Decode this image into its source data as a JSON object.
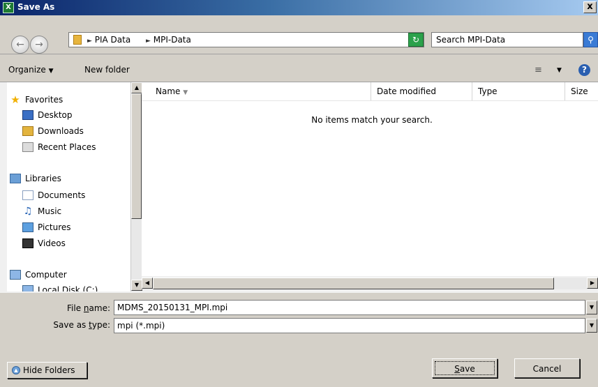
{
  "window": {
    "title": "Save As",
    "close_glyph": "x"
  },
  "address": {
    "crumbs": [
      "PIA Data",
      "MPI-Data"
    ],
    "search_placeholder": "Search MPI-Data"
  },
  "toolbar": {
    "organize_label": "Organize",
    "new_folder_label": "New folder"
  },
  "navigation": {
    "items": [
      {
        "label": "Favorites",
        "icon": "star-icon"
      },
      {
        "label": "Desktop",
        "icon": "desktop-icon"
      },
      {
        "label": "Downloads",
        "icon": "downloads-folder-icon"
      },
      {
        "label": "Recent Places",
        "icon": "recent-places-icon"
      },
      {
        "label": "Libraries",
        "icon": "libraries-icon"
      },
      {
        "label": "Documents",
        "icon": "documents-icon"
      },
      {
        "label": "Music",
        "icon": "music-icon"
      },
      {
        "label": "Pictures",
        "icon": "pictures-icon"
      },
      {
        "label": "Videos",
        "icon": "videos-icon"
      },
      {
        "label": "Computer",
        "icon": "computer-icon"
      },
      {
        "label": "Local Disk (C:)",
        "icon": "disk-icon"
      }
    ]
  },
  "file_list": {
    "columns": [
      "Name",
      "Date modified",
      "Type",
      "Size"
    ],
    "empty_message": "No items match your search."
  },
  "form": {
    "file_name_label_prefix": "File ",
    "file_name_label_underline": "n",
    "file_name_label_suffix": "ame:",
    "file_name_value": "MDMS_20150131_MPI.mpi",
    "save_type_label_prefix": "Save as ",
    "save_type_label_underline": "t",
    "save_type_label_suffix": "ype:",
    "save_type_value": "mpi (*.mpi)"
  },
  "buttons": {
    "hide_folders_label": "Hide Folders",
    "save_underline": "S",
    "save_rest": "ave",
    "cancel_label": "Cancel"
  }
}
